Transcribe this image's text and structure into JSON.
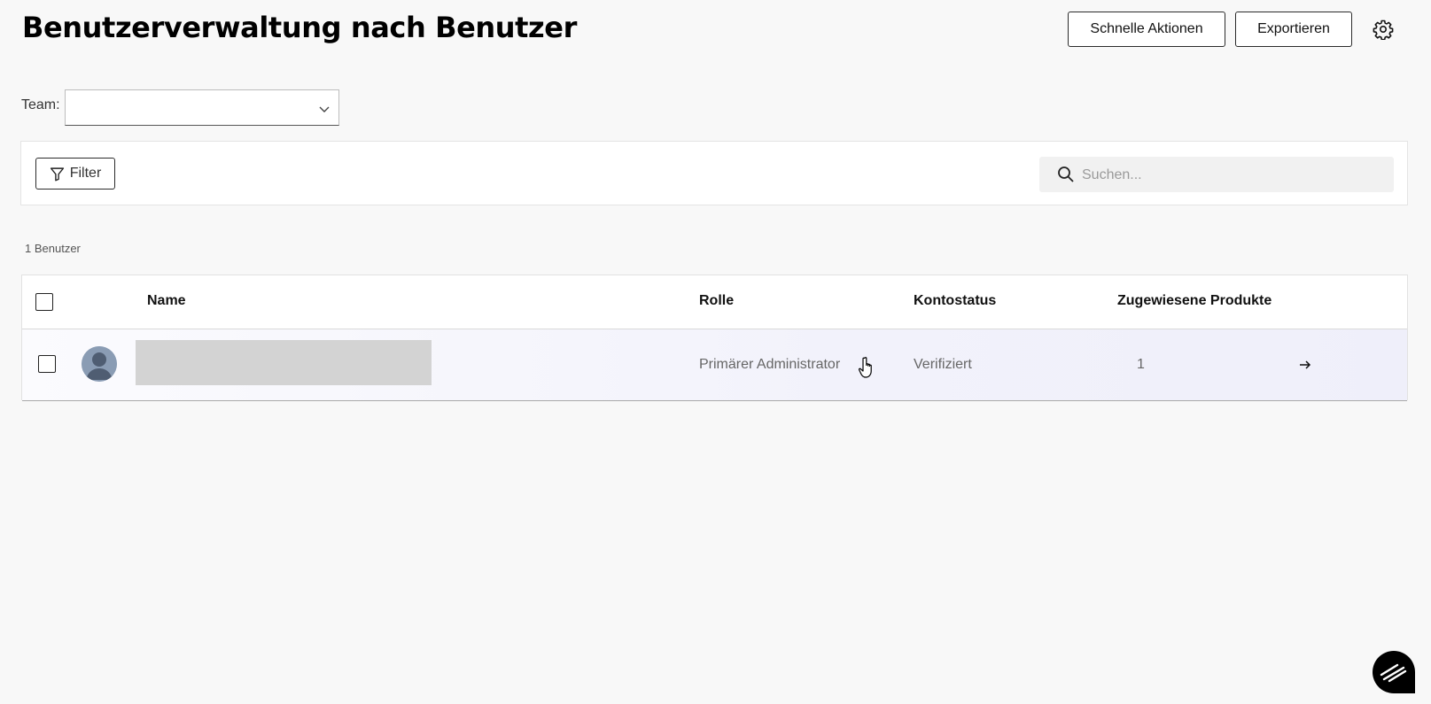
{
  "header": {
    "title": "Benutzerverwaltung nach Benutzer",
    "quick_actions_label": "Schnelle Aktionen",
    "export_label": "Exportieren",
    "settings_icon": "gear-icon"
  },
  "team_filter": {
    "label": "Team:",
    "selected_value": ""
  },
  "toolbar": {
    "filter_label": "Filter",
    "filter_icon": "funnel-icon",
    "search_placeholder": "Suchen...",
    "search_icon": "magnifier-icon"
  },
  "summary": {
    "user_count": "1 Benutzer"
  },
  "table": {
    "columns": {
      "name": "Name",
      "role": "Rolle",
      "account_status": "Kontostatus",
      "assigned_products": "Zugewiesene Produkte"
    },
    "rows": [
      {
        "name": "",
        "role": "Primärer Administrator",
        "account_status": "Verifiziert",
        "assigned_products": "1",
        "name_redacted": true,
        "action_icon": "arrow-right-icon"
      }
    ]
  },
  "colors": {
    "background": "#f8f8f8",
    "row_highlight": "#f2f2fb",
    "redaction": "#d3d3d3",
    "chat_button": "#000000"
  }
}
